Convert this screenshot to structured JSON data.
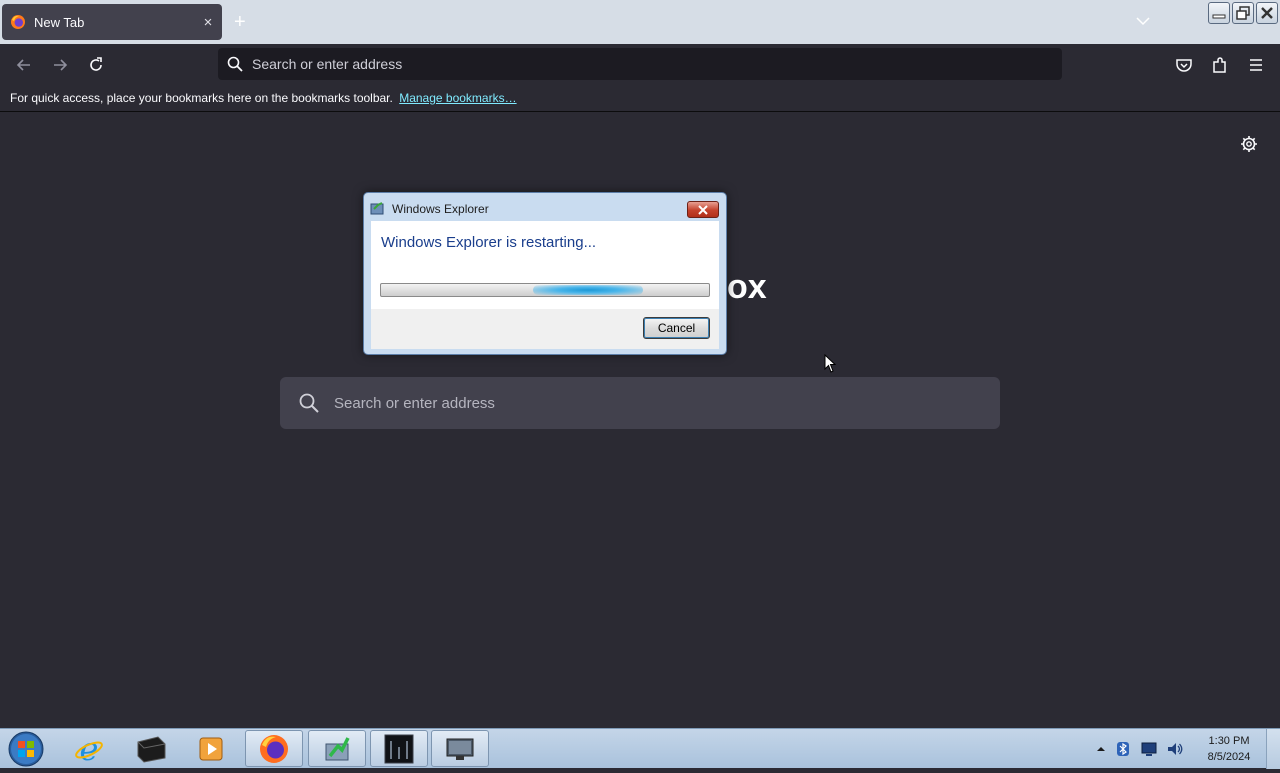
{
  "browser": {
    "tab": {
      "title": "New Tab",
      "close": "×"
    },
    "new_tab": "+",
    "urlbar_placeholder": "Search or enter address",
    "bookmarks_bar": {
      "message": "For quick access, place your bookmarks here on the bookmarks toolbar.",
      "link": "Manage bookmarks…"
    },
    "newtab_page": {
      "brand_fragment": "ox",
      "search_placeholder": "Search or enter address"
    }
  },
  "dialog": {
    "title": "Windows Explorer",
    "message": "Windows Explorer is restarting...",
    "progress": 0.63,
    "cancel_label": "Cancel"
  },
  "taskbar": {
    "pinned": [
      {
        "name": "internet-explorer-icon",
        "open": false
      },
      {
        "name": "black-box-app-icon",
        "open": false
      },
      {
        "name": "media-player-icon",
        "open": false
      },
      {
        "name": "firefox-icon",
        "open": true
      },
      {
        "name": "green-arrow-app-icon",
        "open": true
      },
      {
        "name": "dark-terminal-app-icon",
        "open": true
      },
      {
        "name": "monitor-app-icon",
        "open": true
      }
    ],
    "clock": {
      "time": "1:30 PM",
      "date": "8/5/2024"
    }
  },
  "colors": {
    "browser_bg": "#2b2a33",
    "urlbar_bg": "#1c1b22",
    "link": "#80ebff",
    "dialog_text": "#1a3e8c",
    "taskbar": "#b3c9e0"
  }
}
